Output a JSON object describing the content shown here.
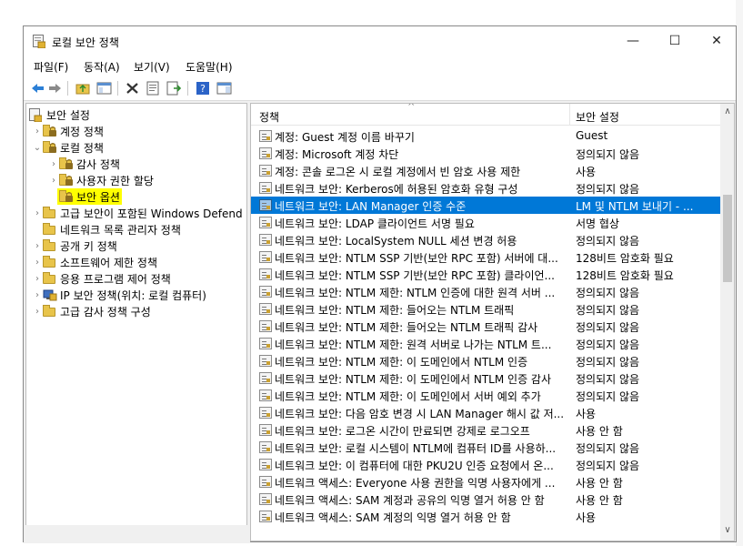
{
  "window": {
    "title": "로컬 보안 정책",
    "controls": {
      "minimize": "—",
      "maximize": "☐",
      "close": "✕"
    }
  },
  "menu": {
    "items": [
      {
        "label": "파일(F)"
      },
      {
        "label": "동작(A)"
      },
      {
        "label": "보기(V)"
      },
      {
        "label": "도움말(H)"
      }
    ]
  },
  "toolbar": {
    "buttons": [
      "back-icon",
      "forward-icon",
      "up-folder-icon",
      "show-hide-tree-icon",
      "delete-icon",
      "properties-icon",
      "export-list-icon",
      "help-icon",
      "show-hide-action-pane-icon"
    ]
  },
  "tree": {
    "root": "보안 설정",
    "nodes": [
      {
        "label": "계정 정책"
      },
      {
        "label": "로컬 정책"
      },
      {
        "label": "감사 정책"
      },
      {
        "label": "사용자 권한 할당"
      },
      {
        "label": "보안 옵션"
      },
      {
        "label": "고급 보안이 포함된 Windows Defend"
      },
      {
        "label": "네트워크 목록 관리자 정책"
      },
      {
        "label": "공개 키 정책"
      },
      {
        "label": "소프트웨어 제한 정책"
      },
      {
        "label": "응용 프로그램 제어 정책"
      },
      {
        "label": "IP 보안 정책(위치: 로컬 컴퓨터)"
      },
      {
        "label": "고급 감사 정책 구성"
      }
    ]
  },
  "list": {
    "columns": {
      "policy": "정책",
      "setting": "보안 설정"
    },
    "sort_indicator": "^",
    "rows": [
      {
        "name": "계정: Guest 계정 이름 바꾸기",
        "setting": "Guest"
      },
      {
        "name": "계정: Microsoft 계정 차단",
        "setting": "정의되지 않음"
      },
      {
        "name": "계정: 콘솔 로그온 시 로컬 계정에서 빈 암호 사용 제한",
        "setting": "사용"
      },
      {
        "name": "네트워크 보안: Kerberos에 허용된 암호화 유형 구성",
        "setting": "정의되지 않음"
      },
      {
        "name": "네트워크 보안: LAN Manager 인증 수준",
        "setting": "LM 및 NTLM 보내기 - ..."
      },
      {
        "name": "네트워크 보안: LDAP 클라이언트 서명 필요",
        "setting": "서명 협상"
      },
      {
        "name": "네트워크 보안: LocalSystem NULL 세션 변경 허용",
        "setting": "정의되지 않음"
      },
      {
        "name": "네트워크 보안: NTLM SSP 기반(보안 RPC 포함) 서버에 대...",
        "setting": "128비트 암호화 필요"
      },
      {
        "name": "네트워크 보안: NTLM SSP 기반(보안 RPC 포함) 클라이언...",
        "setting": "128비트 암호화 필요"
      },
      {
        "name": "네트워크 보안: NTLM 제한: NTLM 인증에 대한 원격 서버 ...",
        "setting": "정의되지 않음"
      },
      {
        "name": "네트워크 보안: NTLM 제한: 들어오는 NTLM 트래픽",
        "setting": "정의되지 않음"
      },
      {
        "name": "네트워크 보안: NTLM 제한: 들어오는 NTLM 트래픽 감사",
        "setting": "정의되지 않음"
      },
      {
        "name": "네트워크 보안: NTLM 제한: 원격 서버로 나가는 NTLM 트...",
        "setting": "정의되지 않음"
      },
      {
        "name": "네트워크 보안: NTLM 제한: 이 도메인에서 NTLM 인증",
        "setting": "정의되지 않음"
      },
      {
        "name": "네트워크 보안: NTLM 제한: 이 도메인에서 NTLM 인증 감사",
        "setting": "정의되지 않음"
      },
      {
        "name": "네트워크 보안: NTLM 제한: 이 도메인에서 서버 예외 추가",
        "setting": "정의되지 않음"
      },
      {
        "name": "네트워크 보안: 다음 암호 변경 시 LAN Manager 해시 값 저...",
        "setting": "사용"
      },
      {
        "name": "네트워크 보안: 로그온 시간이 만료되면 강제로 로그오프",
        "setting": "사용 안 함"
      },
      {
        "name": "네트워크 보안: 로컬 시스템이 NTLM에 컴퓨터 ID를 사용하...",
        "setting": "정의되지 않음"
      },
      {
        "name": "네트워크 보안: 이 컴퓨터에 대한 PKU2U 인증 요청에서 온...",
        "setting": "정의되지 않음"
      },
      {
        "name": "네트워크 액세스: Everyone 사용 권한을 익명 사용자에게 ...",
        "setting": "사용 안 함"
      },
      {
        "name": "네트워크 액세스: SAM 계정과 공유의 익명 열거 허용 안 함",
        "setting": "사용 안 함"
      },
      {
        "name": "네트워크 액세스: SAM 계정의 익명 열거 허용 안 함",
        "setting": "사용"
      }
    ]
  },
  "scroll": {
    "up": "∧",
    "down": "∨",
    "left": "<",
    "right": ">"
  },
  "colors": {
    "selection": "#0078d7",
    "highlight": "#ffff00"
  }
}
